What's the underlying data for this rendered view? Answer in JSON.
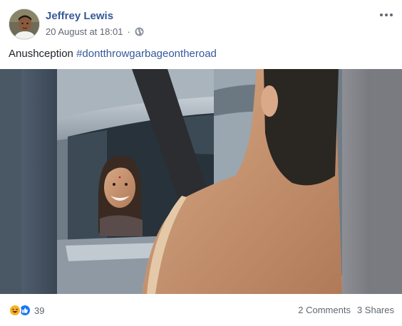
{
  "post": {
    "author_name": "Jeffrey Lewis",
    "timestamp": "20 August at 18:01",
    "separator": "·",
    "privacy_icon": "globe-icon",
    "menu_icon": "more-options-icon",
    "caption_text": "Anushception",
    "caption_hashtag": "#dontthrowgarbageontheroad",
    "media_type": "video-still"
  },
  "footer": {
    "reaction_icons": [
      "haha-reaction-icon",
      "like-reaction-icon"
    ],
    "reaction_count": "39",
    "comments_label": "2 Comments",
    "shares_label": "3 Shares"
  },
  "colors": {
    "name_link": "#365899",
    "secondary_text": "#616770",
    "like_blue": "#1877f2",
    "haha_yellow": "#f7b125"
  }
}
